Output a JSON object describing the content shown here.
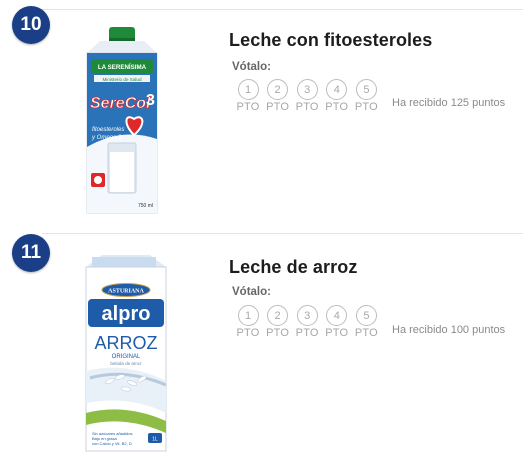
{
  "products": [
    {
      "rank": "10",
      "name": "Leche con fitoesteroles",
      "vote_label": "Vótalo:",
      "options": [
        "1",
        "2",
        "3",
        "4",
        "5"
      ],
      "unit": "PTO",
      "received": "Ha recibido 125 puntos",
      "packaging": {
        "brand": "LA SERENÍSIMA",
        "seal": "Ministerio de Salud",
        "product": "SereCol",
        "superscript": "3",
        "desc_line1": "fitoesteroles",
        "desc_line2": "y Omega 3",
        "volume": "750 ml"
      }
    },
    {
      "rank": "11",
      "name": "Leche de arroz",
      "vote_label": "Vótalo:",
      "options": [
        "1",
        "2",
        "3",
        "4",
        "5"
      ],
      "unit": "PTO",
      "received": "Ha recibido 100 puntos",
      "packaging": {
        "maker": "ASTURIANA",
        "brand": "alpro",
        "product": "ARROZ",
        "variant": "ORIGINAL",
        "tagline": "bebida de arroz",
        "footer1": "Sin azúcares añadidos",
        "footer2": "Bajo en grasa",
        "footer3": "con Calcio y Vit. B2, D",
        "badge": "1L"
      }
    }
  ],
  "colors": {
    "rank_badge": "#1b3f87",
    "option_ring": "#bdbdbd",
    "pack_blue": "#2a73b8",
    "pack_red": "#e0282a",
    "alpro_blue": "#1e5ba8",
    "alpro_green": "#8dbd45"
  }
}
